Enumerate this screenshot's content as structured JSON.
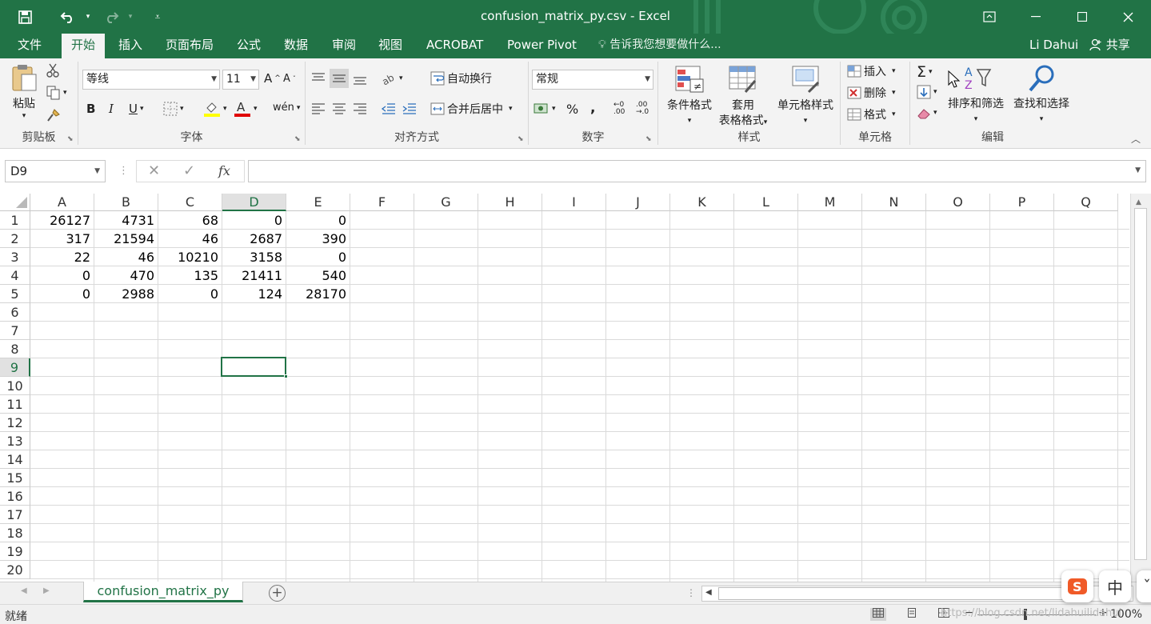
{
  "titlebar": {
    "title": "confusion_matrix_py.csv - Excel",
    "save_icon": "floppy-icon",
    "undo_icon": "undo-icon",
    "redo_icon": "redo-icon",
    "customize_icon": "customize-qat-icon"
  },
  "tabs": [
    "文件",
    "开始",
    "插入",
    "页面布局",
    "公式",
    "数据",
    "审阅",
    "视图",
    "ACROBAT",
    "Power Pivot"
  ],
  "active_tab": "开始",
  "tell_me": "告诉我您想要做什么...",
  "user": "Li Dahui",
  "share": "共享",
  "ribbon": {
    "clipboard": {
      "paste": "粘贴",
      "label": "剪贴板"
    },
    "font": {
      "name": "等线",
      "size": "11",
      "bold": "B",
      "italic": "I",
      "underline": "U",
      "label": "字体"
    },
    "alignment": {
      "wrap": "自动换行",
      "merge": "合并后居中",
      "label": "对齐方式"
    },
    "number": {
      "format": "常规",
      "percent": "%",
      "comma": ",",
      "label": "数字"
    },
    "styles": {
      "conditional": "条件格式",
      "table_a": "套用",
      "table_b": "表格格式",
      "cell_styles": "单元格样式",
      "label": "样式"
    },
    "cells": {
      "insert": "插入",
      "delete": "删除",
      "format": "格式",
      "label": "单元格"
    },
    "editing": {
      "sort": "排序和筛选",
      "find": "查找和选择",
      "label": "编辑"
    }
  },
  "formula_bar": {
    "name_box": "D9",
    "cancel": "✕",
    "enter": "✓",
    "fx": "fx",
    "formula": ""
  },
  "columns": [
    "A",
    "B",
    "C",
    "D",
    "E",
    "F",
    "G",
    "H",
    "I",
    "J",
    "K",
    "L",
    "M",
    "N",
    "O",
    "P",
    "Q"
  ],
  "rows": [
    "1",
    "2",
    "3",
    "4",
    "5",
    "6",
    "7",
    "8",
    "9",
    "10",
    "11",
    "12",
    "13",
    "14",
    "15",
    "16",
    "17",
    "18",
    "19",
    "20"
  ],
  "cells": [
    [
      "26127",
      "4731",
      "68",
      "0",
      "0"
    ],
    [
      "317",
      "21594",
      "46",
      "2687",
      "390"
    ],
    [
      "22",
      "46",
      "10210",
      "3158",
      "0"
    ],
    [
      "0",
      "470",
      "135",
      "21411",
      "540"
    ],
    [
      "0",
      "2988",
      "0",
      "124",
      "28170"
    ]
  ],
  "selection": {
    "column": "D",
    "row": "9"
  },
  "sheet_tab": "confusion_matrix_py",
  "status": {
    "ready": "就绪",
    "zoom": "100%"
  },
  "watermark": "https://blog.csdn.net/lidahuilidahui",
  "ime": {
    "sogou": "S",
    "mode": "中",
    "punct": "ˇ"
  },
  "colors": {
    "accent": "#217346",
    "ribbon_bg": "#f3f3f3",
    "grid_line": "#dadada"
  }
}
